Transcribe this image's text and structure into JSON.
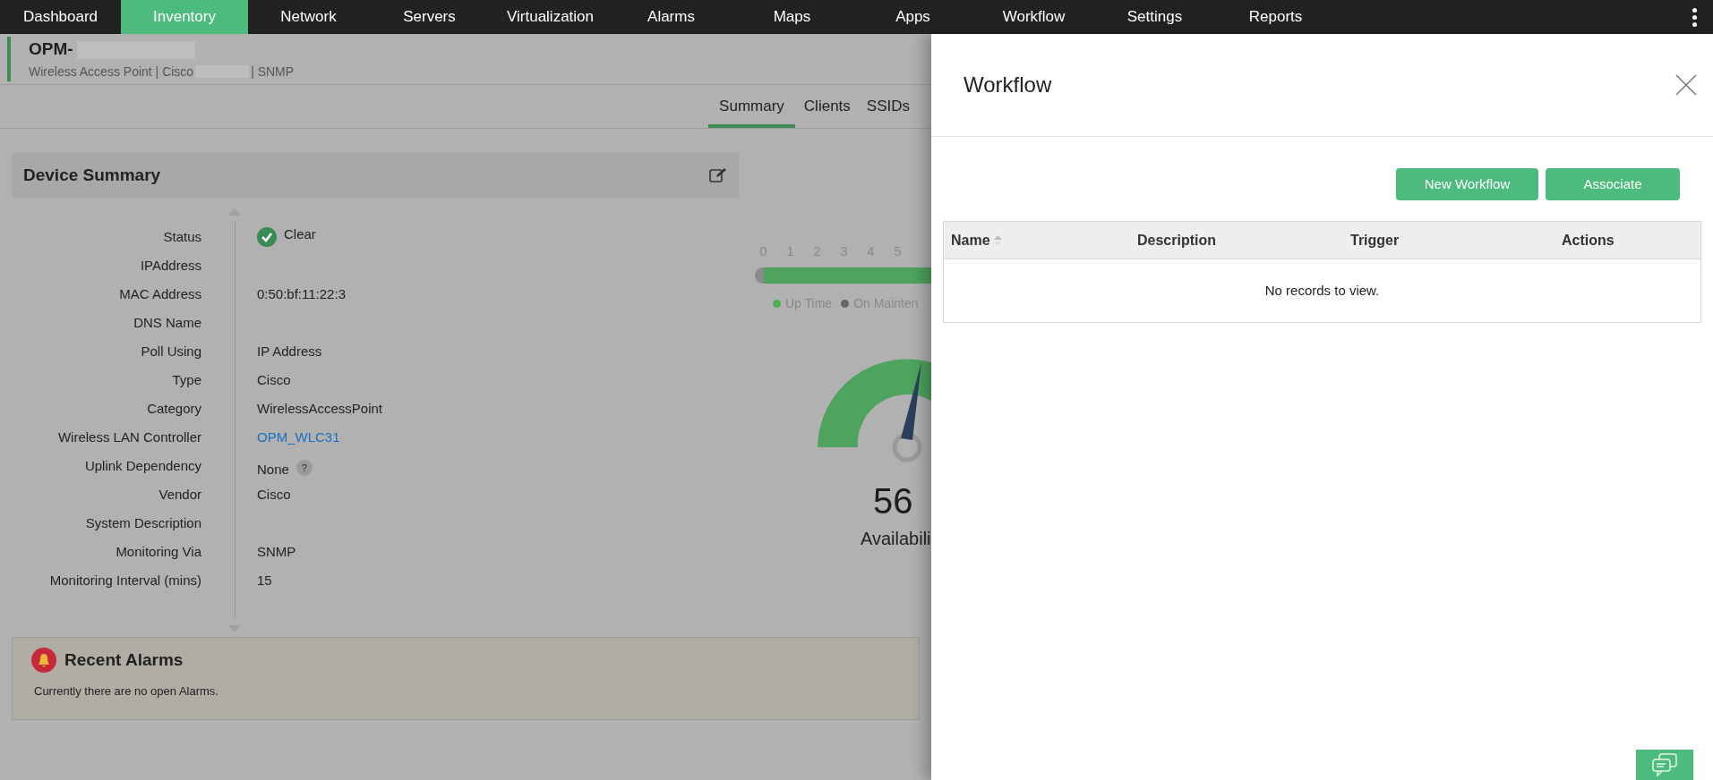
{
  "nav": [
    {
      "label": "Dashboard",
      "selected": false
    },
    {
      "label": "Inventory",
      "selected": true
    },
    {
      "label": "Network",
      "selected": false
    },
    {
      "label": "Servers",
      "selected": false
    },
    {
      "label": "Virtualization",
      "selected": false
    },
    {
      "label": "Alarms",
      "selected": false
    },
    {
      "label": "Maps",
      "selected": false
    },
    {
      "label": "Apps",
      "selected": false
    },
    {
      "label": "Workflow",
      "selected": false
    },
    {
      "label": "Settings",
      "selected": false
    },
    {
      "label": "Reports",
      "selected": false
    }
  ],
  "device": {
    "title": "OPM-",
    "subtitle_start": "Wireless Access Point | Cisco",
    "subtitle_end": "| SNMP"
  },
  "tabs": [
    {
      "label": "Summary",
      "selected": true
    },
    {
      "label": "Clients",
      "selected": false
    },
    {
      "label": "SSIDs",
      "selected": false
    }
  ],
  "summary": {
    "title": "Device Summary",
    "rows": [
      {
        "label": "Status",
        "value": "Clear",
        "kind": "status"
      },
      {
        "label": "IPAddress",
        "kind": "text"
      },
      {
        "label": "MAC Address",
        "value": "0:50:bf:11:22:3",
        "kind": "text"
      },
      {
        "label": "DNS Name",
        "kind": "text"
      },
      {
        "label": "Poll Using",
        "value": "IP Address",
        "kind": "text"
      },
      {
        "label": "Type",
        "value": "Cisco",
        "kind": "text"
      },
      {
        "label": "Category",
        "value": "WirelessAccessPoint",
        "kind": "text"
      },
      {
        "label": "Wireless LAN Controller",
        "value": "OPM_WLC31",
        "kind": "link"
      },
      {
        "label": "Uplink Dependency",
        "value": "None",
        "kind": "help",
        "help": "?"
      },
      {
        "label": "Vendor",
        "value": "Cisco",
        "kind": "text"
      },
      {
        "label": "System Description",
        "kind": "text"
      },
      {
        "label": "Monitoring Via",
        "value": "SNMP",
        "kind": "text"
      },
      {
        "label": "Monitoring Interval (mins)",
        "value": "15",
        "kind": "text"
      }
    ]
  },
  "timeline": {
    "ticks": [
      "0",
      "1",
      "2",
      "3",
      "4",
      "5"
    ],
    "legend": [
      {
        "label": "Up Time",
        "color": "#4caf50"
      },
      {
        "label": "On Mainten",
        "color": "#666666"
      }
    ]
  },
  "availability": {
    "value": "56",
    "label": "Availabili"
  },
  "alarms": {
    "title": "Recent Alarms",
    "message": "Currently there are no open Alarms."
  },
  "workflow_panel": {
    "title": "Workflow",
    "buttons": [
      "New Workflow",
      "Associate"
    ],
    "columns": [
      "Name",
      "Description",
      "Trigger",
      "Actions"
    ],
    "empty_message": "No records to view."
  }
}
